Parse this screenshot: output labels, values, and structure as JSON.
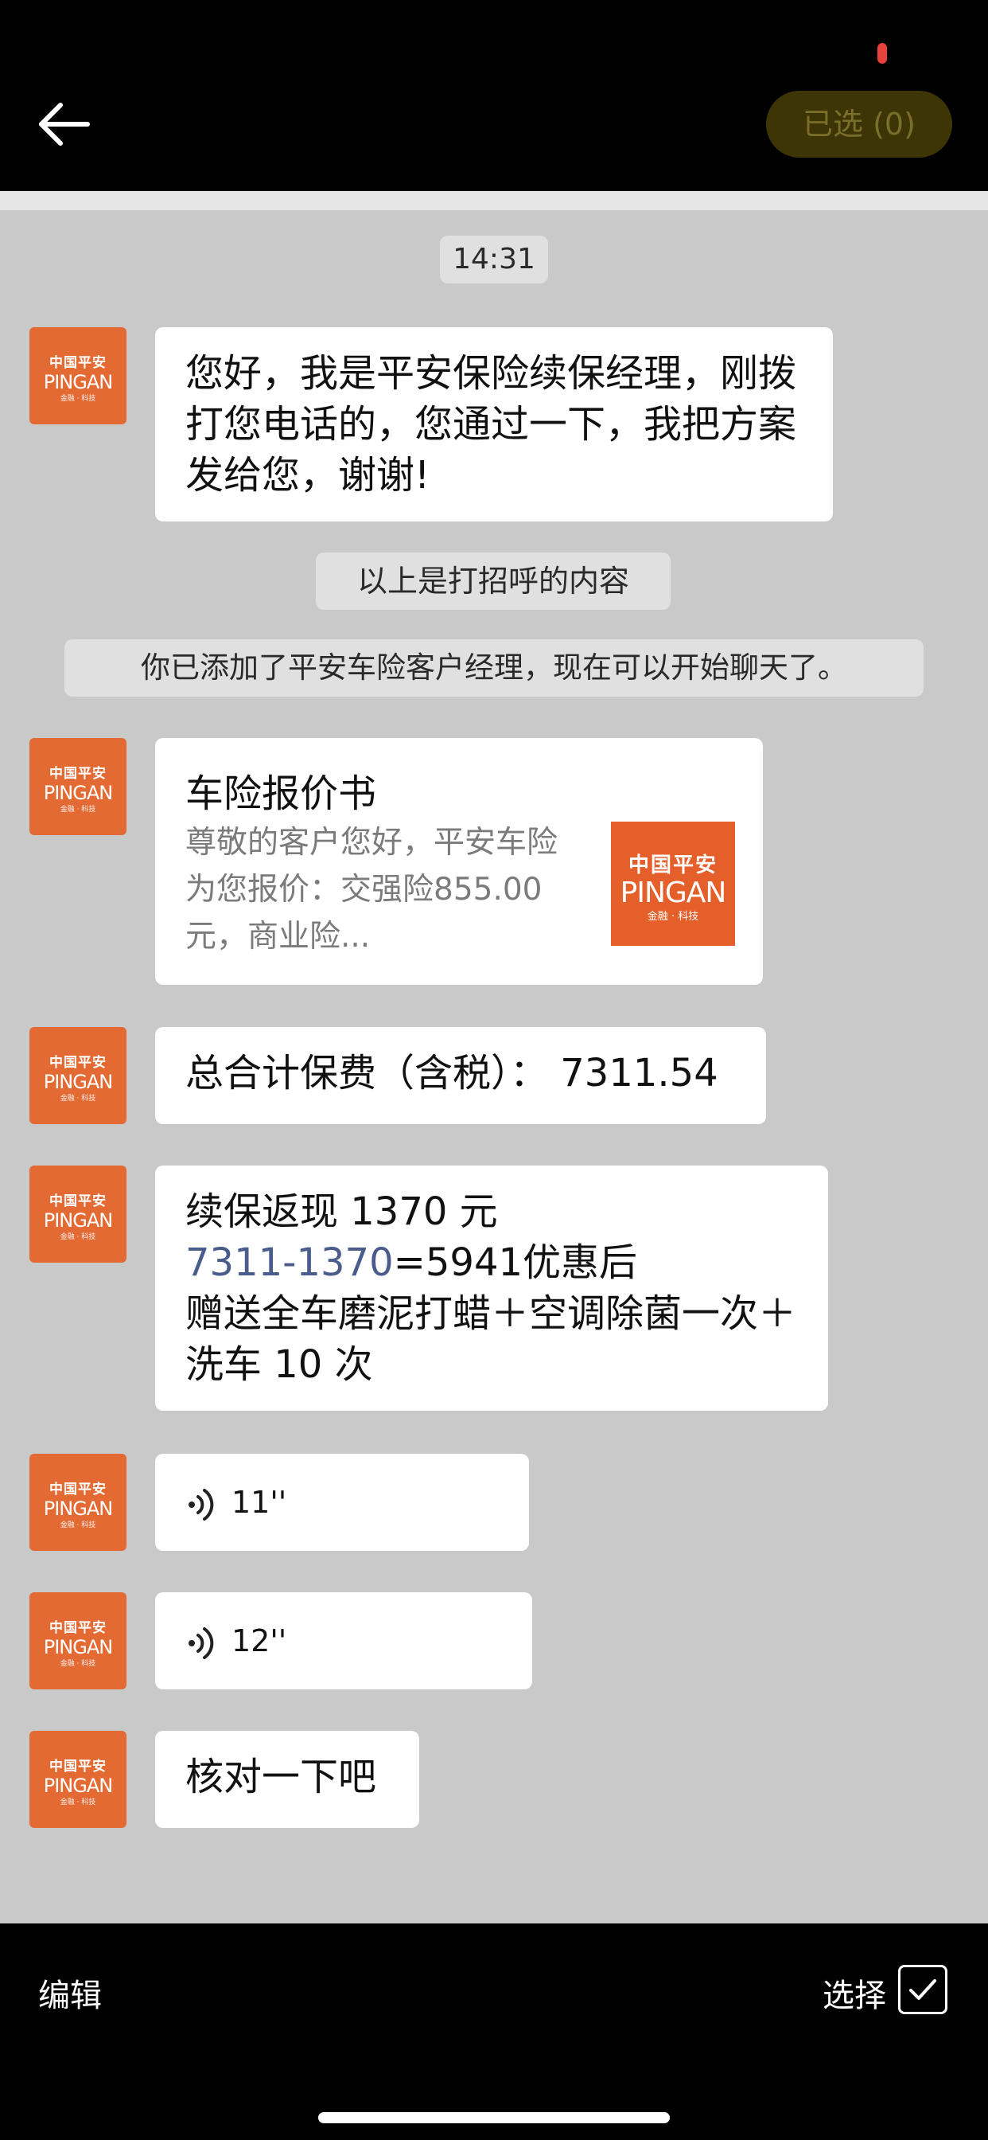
{
  "header": {
    "selected_label": "已选 (0)"
  },
  "chat": {
    "timestamp": "14:31",
    "greeting_message": "您好，我是平安保险续保经理，刚拨打您电话的，您通过一下，我把方案发给您，谢谢!",
    "system_note_greeting": "以上是打招呼的内容",
    "system_note_added": "你已添加了平安车险客户经理，现在可以开始聊天了。",
    "card": {
      "title": "车险报价书",
      "description": "尊敬的客户您好，平安车险为您报价：交强险855.00元，商业险...",
      "logo_text_cn": "中国平安",
      "logo_text_en": "PINGAN",
      "logo_sub": "金融 · 科技"
    },
    "total_message": "总合计保费（含税）： 7311.54",
    "cashback": {
      "line1": "续保返现 1370 元",
      "link_text": "7311-1370",
      "line2_rest": "=5941优惠后",
      "line3": "赠送全车磨泥打蜡＋空调除菌一次＋洗车 10 次"
    },
    "voice1_duration": "11''",
    "voice2_duration": "12''",
    "last_message": "核对一下吧"
  },
  "avatar": {
    "cn": "中国平安",
    "en": "PINGAN",
    "sub": "金融 · 科技"
  },
  "footer": {
    "edit_label": "编辑",
    "select_label": "选择"
  },
  "colors": {
    "brand_orange": "#e46a33",
    "chat_background": "#c9c9c9",
    "link_blue": "#4a5c8c"
  }
}
